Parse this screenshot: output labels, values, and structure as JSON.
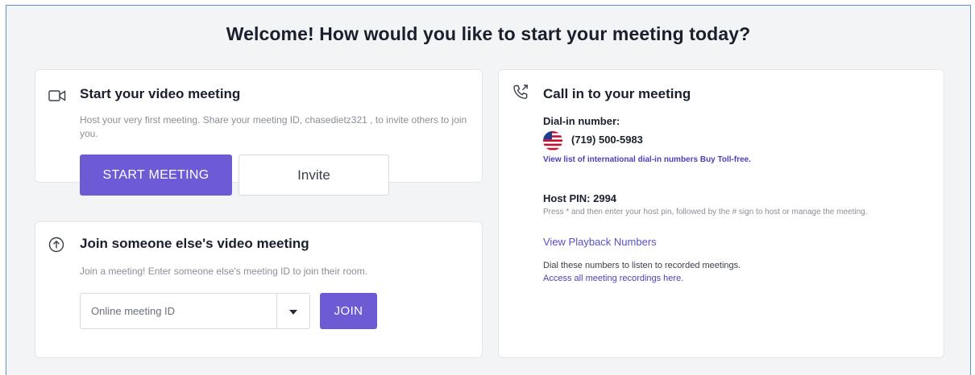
{
  "page": {
    "title": "Welcome! How would you like to start your meeting today?"
  },
  "start_card": {
    "icon": "video-camera-icon",
    "title": "Start your video meeting",
    "description": "Host your very first meeting. Share your meeting ID, chasedietz321 , to invite others to join you.",
    "start_button_label": "START MEETING",
    "invite_button_label": "Invite"
  },
  "join_card": {
    "icon": "arrow-up-circle-icon",
    "title": "Join someone else's video meeting",
    "description": "Join a meeting! Enter someone else's meeting ID to join their room.",
    "input_value": "",
    "input_placeholder": "Online meeting ID",
    "dropdown_icon": "caret-down-icon",
    "join_button_label": "JOIN"
  },
  "call_card": {
    "icon": "phone-outgoing-icon",
    "title": "Call in to your meeting",
    "dial_in_label": "Dial-in number:",
    "flag_icon": "us-flag-icon",
    "dial_in_number": "(719) 500-5983",
    "international_link": "View list of international dial-in numbers Buy Toll-free.",
    "host_pin_label": "Host PIN: 2994",
    "host_pin_description": "Press * and then enter your host pin, followed by the # sign to host or manage the meeting.",
    "playback_link": "View Playback Numbers",
    "playback_description": "Dial these numbers to listen to recorded meetings.",
    "recordings_link": "Access all meeting recordings here."
  },
  "colors": {
    "accent": "#6c5bd5",
    "link": "#4b42b8",
    "background": "#f3f4f6",
    "frame_border": "#5b8fd6"
  }
}
